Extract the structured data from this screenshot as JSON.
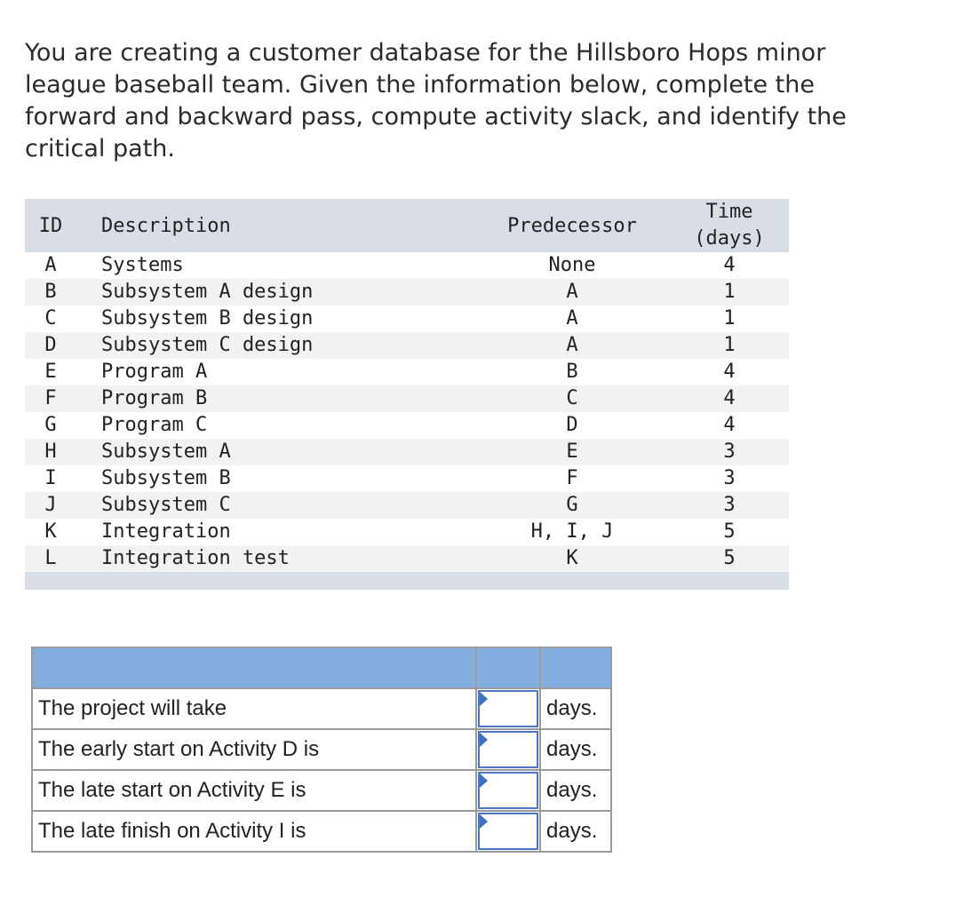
{
  "question": "You are creating a customer database for the Hillsboro Hops minor league baseball team. Given the information below, complete the forward and backward pass, compute activity slack, and identify the critical path.",
  "activity_table": {
    "headers": {
      "id": "ID",
      "description": "Description",
      "predecessor": "Predecessor",
      "time_line1": "Time",
      "time_line2": "(days)"
    },
    "rows": [
      {
        "id": "A",
        "description": "Systems",
        "predecessor": "None",
        "time": "4"
      },
      {
        "id": "B",
        "description": "Subsystem A design",
        "predecessor": "A",
        "time": "1"
      },
      {
        "id": "C",
        "description": "Subsystem B design",
        "predecessor": "A",
        "time": "1"
      },
      {
        "id": "D",
        "description": "Subsystem C design",
        "predecessor": "A",
        "time": "1"
      },
      {
        "id": "E",
        "description": "Program A",
        "predecessor": "B",
        "time": "4"
      },
      {
        "id": "F",
        "description": "Program B",
        "predecessor": "C",
        "time": "4"
      },
      {
        "id": "G",
        "description": "Program C",
        "predecessor": "D",
        "time": "4"
      },
      {
        "id": "H",
        "description": "Subsystem A",
        "predecessor": "E",
        "time": "3"
      },
      {
        "id": "I",
        "description": "Subsystem B",
        "predecessor": "F",
        "time": "3"
      },
      {
        "id": "J",
        "description": "Subsystem C",
        "predecessor": "G",
        "time": "3"
      },
      {
        "id": "K",
        "description": "Integration",
        "predecessor": "H, I, J",
        "time": "5"
      },
      {
        "id": "L",
        "description": "Integration test",
        "predecessor": "K",
        "time": "5"
      }
    ]
  },
  "answer_table": {
    "rows": [
      {
        "label": "The project will take",
        "value": "",
        "unit": "days."
      },
      {
        "label": "The early start on Activity D is",
        "value": "",
        "unit": "days."
      },
      {
        "label": "The late start on Activity E is",
        "value": "",
        "unit": "days."
      },
      {
        "label": "The late finish on Activity I is",
        "value": "",
        "unit": "days."
      }
    ]
  },
  "colors": {
    "header_band": "#d8dde6",
    "answer_header": "#84aee0",
    "input_border": "#4a78c2"
  }
}
